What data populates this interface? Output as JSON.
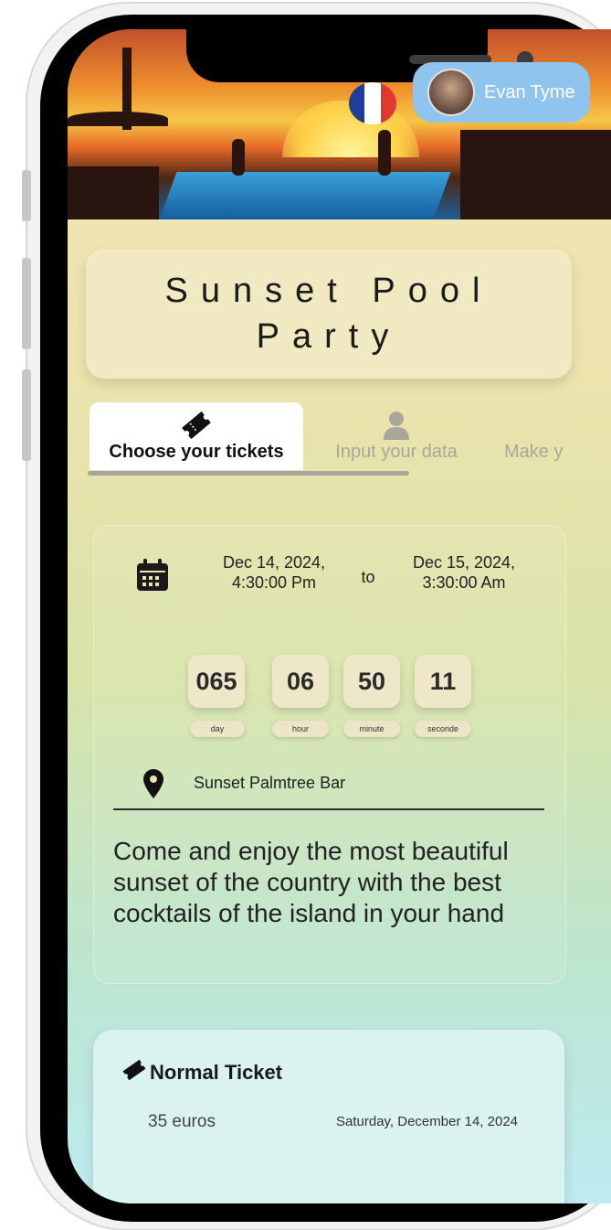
{
  "header": {
    "user_name": "Evan Tyme",
    "flag_colors": [
      "#1f3d9b",
      "#ffffff",
      "#e03a2e"
    ]
  },
  "event": {
    "title": "Sunset Pool Party"
  },
  "tabs": [
    {
      "label": "Choose your tickets",
      "icon": "ticket-icon",
      "active": true
    },
    {
      "label": "Input your data",
      "icon": "person-icon",
      "active": false
    },
    {
      "label": "Make y",
      "icon": "",
      "active": false
    }
  ],
  "details": {
    "calendar_icon": "calendar-icon",
    "start_date": "Dec 14, 2024,",
    "start_time": "4:30:00 Pm",
    "to_label": "to",
    "end_date": "Dec 15, 2024,",
    "end_time": "3:30:00 Am",
    "countdown": [
      {
        "value": "065",
        "unit": "day"
      },
      {
        "value": "06",
        "unit": "hour"
      },
      {
        "value": "50",
        "unit": "minute"
      },
      {
        "value": "11",
        "unit": "seconde"
      }
    ],
    "location_icon": "location-pin-icon",
    "location": "Sunset Palmtree Bar",
    "description": "Come and enjoy the most beautiful sunset of the country with the best cocktails of the island in your hand"
  },
  "tickets": [
    {
      "icon": "ticket-icon",
      "name": "Normal Ticket",
      "price": "35 euros",
      "date": "Saturday, December 14, 2024"
    }
  ]
}
